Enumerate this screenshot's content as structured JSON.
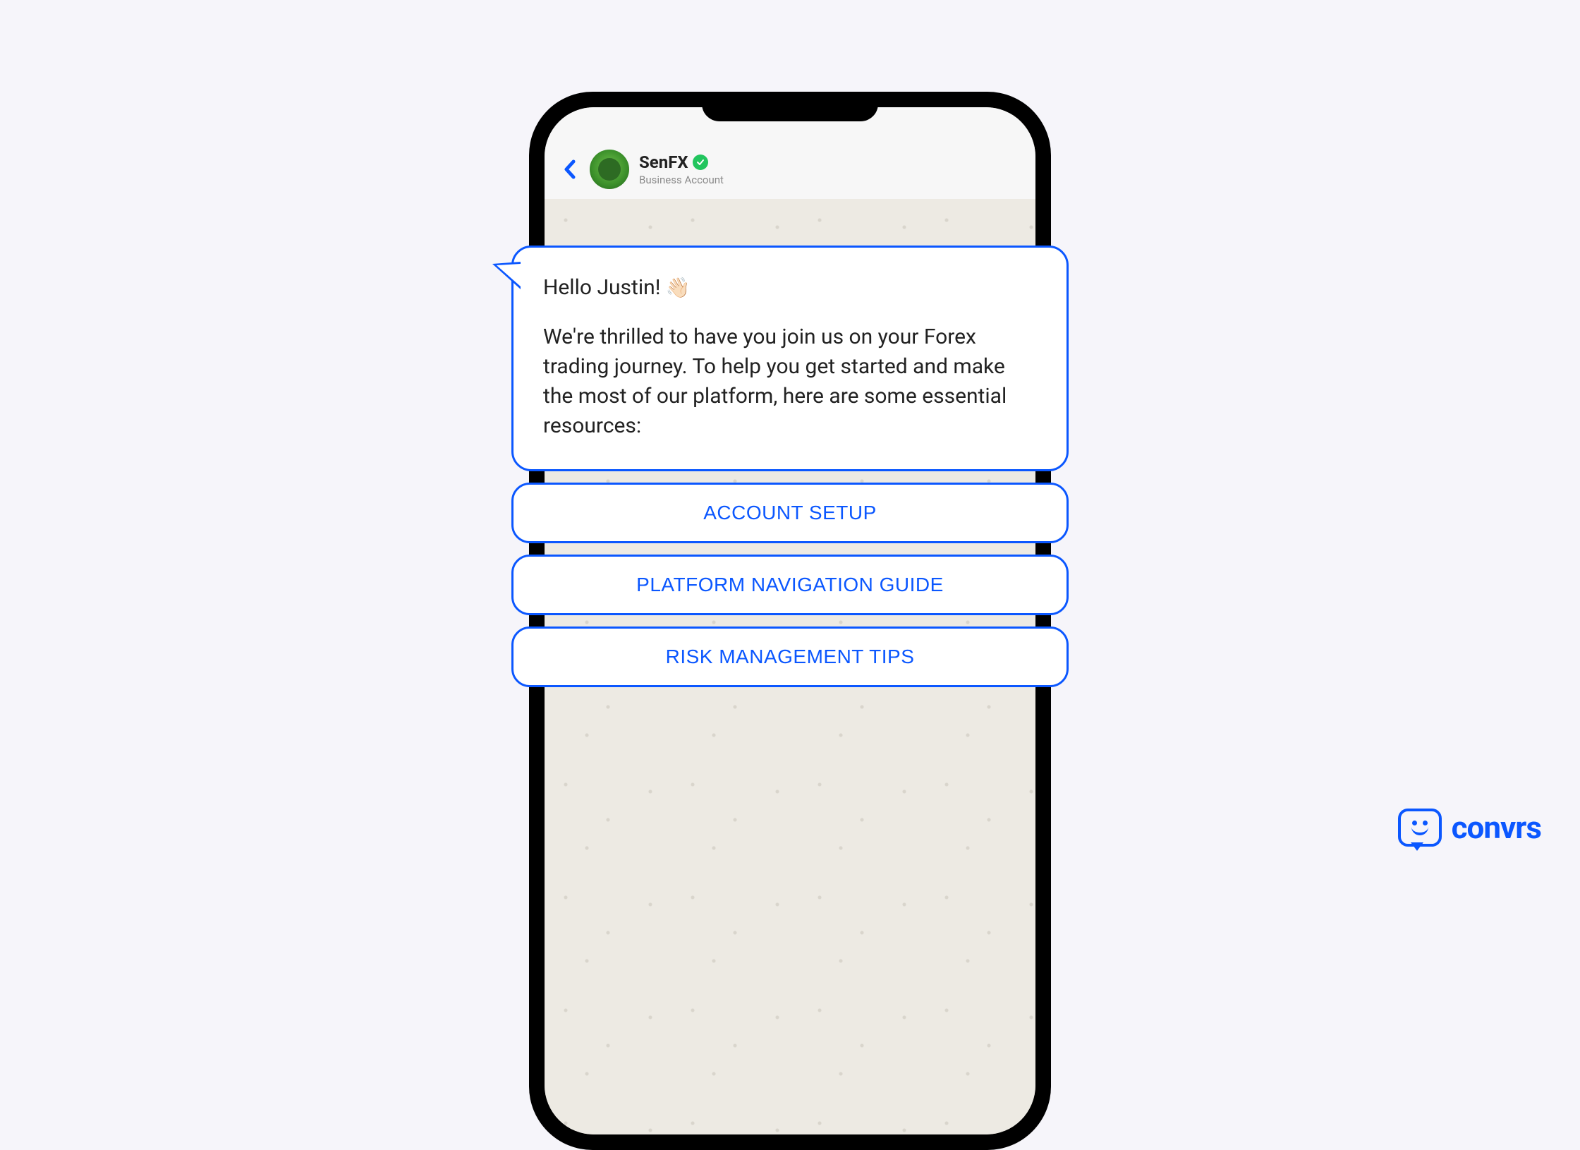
{
  "header": {
    "name": "SenFX",
    "subtitle": "Business Account"
  },
  "message": {
    "greeting": "Hello Justin!",
    "wave": "👋🏻",
    "body": "We're thrilled to have you join us on your Forex trading journey. To help you get started and make the most of our platform, here are some essential resources:"
  },
  "options": [
    "ACCOUNT SETUP",
    "PLATFORM NAVIGATION GUIDE",
    "RISK MANAGEMENT TIPS"
  ],
  "brand": {
    "name": "convrs"
  }
}
